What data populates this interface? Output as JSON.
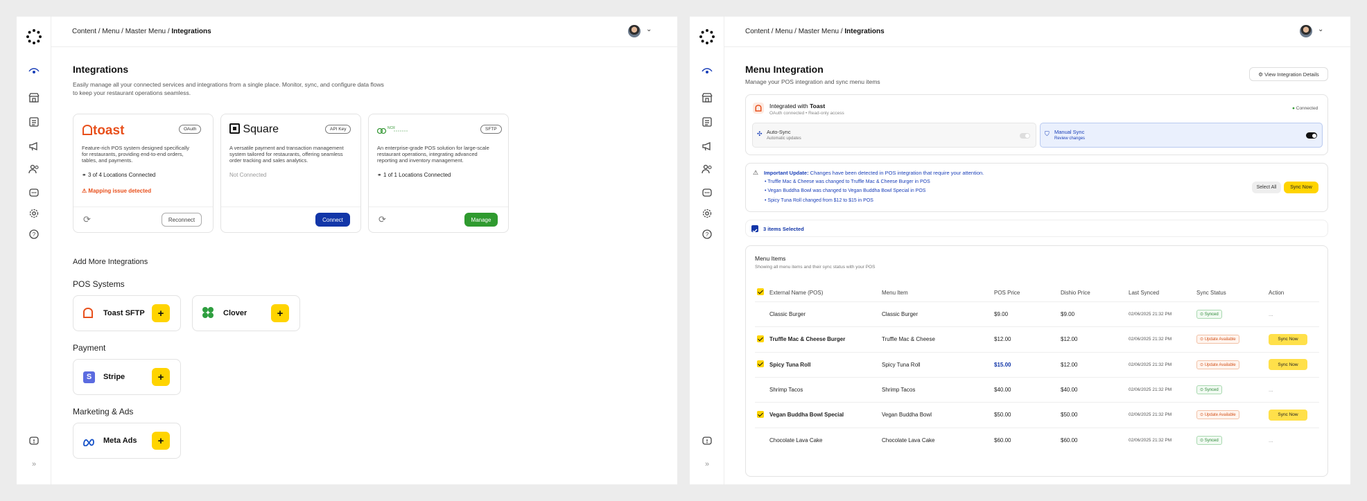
{
  "left": {
    "breadcrumb": {
      "trail": "Content / Menu / Master Menu / ",
      "current": "Integrations"
    },
    "title": "Integrations",
    "description1": "Easily manage all your connected services and integrations from a single place. Monitor, sync, and configure data flows",
    "description2": "to keep your restaurant operations seamless.",
    "cards": [
      {
        "name": "toast",
        "badge": "OAuth",
        "desc1": "Feature-rich POS system designed specifically",
        "desc2": "for restaurants, providing end-to-end orders,",
        "desc3": "tables, and payments.",
        "status": "3 of 4 Locations Connected",
        "warning": "Mapping issue detected",
        "action": "Reconnect"
      },
      {
        "name": "Square",
        "badge": "API Key",
        "desc1": "A versatile payment and transaction management",
        "desc2": "system tailored for restaurants, offering seamless",
        "desc3": "order tracking and sales analytics.",
        "status": "Not Connected",
        "action": "Connect"
      },
      {
        "name": "NCR",
        "badge": "SFTP",
        "desc1": "An enterprise-grade POS solution for large-scale",
        "desc2": "restaurant operations, integrating advanced",
        "desc3": "reporting and inventory management.",
        "status": "1 of 1 Locations Connected",
        "action": "Manage"
      }
    ],
    "add_more": "Add More Integrations",
    "sections": [
      {
        "title": "POS Systems",
        "items": [
          "Toast SFTP",
          "Clover"
        ]
      },
      {
        "title": "Payment",
        "items": [
          "Stripe"
        ]
      },
      {
        "title": "Marketing & Ads",
        "items": [
          "Meta Ads"
        ]
      }
    ],
    "add_symbol": "+"
  },
  "right": {
    "breadcrumb": {
      "trail": "Content / Menu / Master Menu / ",
      "current": "Integrations"
    },
    "title": "Menu Integration",
    "subtitle": "Manage your POS integration and sync menu items",
    "view_details": "View Integration Details",
    "integration": {
      "prefix": "Integrated with ",
      "name": "Toast",
      "meta": "OAuth connected • Read-only access",
      "status": "Connected"
    },
    "auto_sync": {
      "label": "Auto-Sync",
      "sub": "Automatic updates"
    },
    "manual_sync": {
      "label": "Manual Sync",
      "sub": "Review changes"
    },
    "alert": {
      "title": "Important Update:",
      "text": " Changes have been detected in POS integration that require your attention.",
      "changes": [
        "• Truffle Mac & Cheese was changed to Truffle Mac & Cheese Burger in POS",
        "• Vegan Buddha Bowl was changed to Vegan Buddha Bowl Special in POS",
        "• Spicy Tuna Roll changed from $12 to $15 in POS"
      ],
      "select_all": "Select All",
      "sync_now": "Sync Now"
    },
    "selected": "3 items Selected",
    "menu_items": {
      "title": "Menu Items",
      "subtitle": "Showing all menu items and their sync status with your POS",
      "headers": [
        "External Name (POS)",
        "Menu Item",
        "POS Price",
        "Dishio Price",
        "Last Synced",
        "Sync Status",
        "Action"
      ],
      "rows": [
        {
          "ext": "Classic Burger",
          "item": "Classic Burger",
          "pos": "$9.00",
          "dishio": "$9.00",
          "synced": "02/06/2025 21:32 PM",
          "status": "Synced",
          "action": "..."
        },
        {
          "ext": "Truffle Mac & Cheese Burger",
          "item": "Truffle Mac & Cheese",
          "pos": "$12.00",
          "dishio": "$12.00",
          "synced": "02/06/2025 21:32 PM",
          "status": "Update Available",
          "action": "Sync Now"
        },
        {
          "ext": "Spicy Tuna Roll",
          "item": "Spicy Tuna Roll",
          "pos": "$15.00",
          "dishio": "$12.00",
          "synced": "02/06/2025 21:32 PM",
          "status": "Update Available",
          "action": "Sync Now"
        },
        {
          "ext": "Shrimp Tacos",
          "item": "Shrimp Tacos",
          "pos": "$40.00",
          "dishio": "$40.00",
          "synced": "02/06/2025 21:32 PM",
          "status": "Synced",
          "action": "..."
        },
        {
          "ext": "Vegan Buddha Bowl Special",
          "item": "Vegan Buddha Bowl",
          "pos": "$50.00",
          "dishio": "$50.00",
          "synced": "02/06/2025 21:32 PM",
          "status": "Update Available",
          "action": "Sync Now"
        },
        {
          "ext": "Chocolate Lava Cake",
          "item": "Chocolate Lava Cake",
          "pos": "$60.00",
          "dishio": "$60.00",
          "synced": "02/06/2025 21:32 PM",
          "status": "Synced",
          "action": "..."
        }
      ]
    }
  },
  "colors": {
    "toast": "#e8501c",
    "accent_yellow": "#ffd400",
    "connect_blue": "#1236a8",
    "manage_green": "#2f9a2f",
    "link_blue": "#1a3fb8",
    "warn": "#e8501c"
  },
  "icons": [
    "logo-icon",
    "eye-icon",
    "store-icon",
    "menu-book-icon",
    "megaphone-icon",
    "users-icon",
    "chat-icon",
    "gear-icon",
    "help-icon",
    "feedback-icon",
    "expand-icon"
  ]
}
